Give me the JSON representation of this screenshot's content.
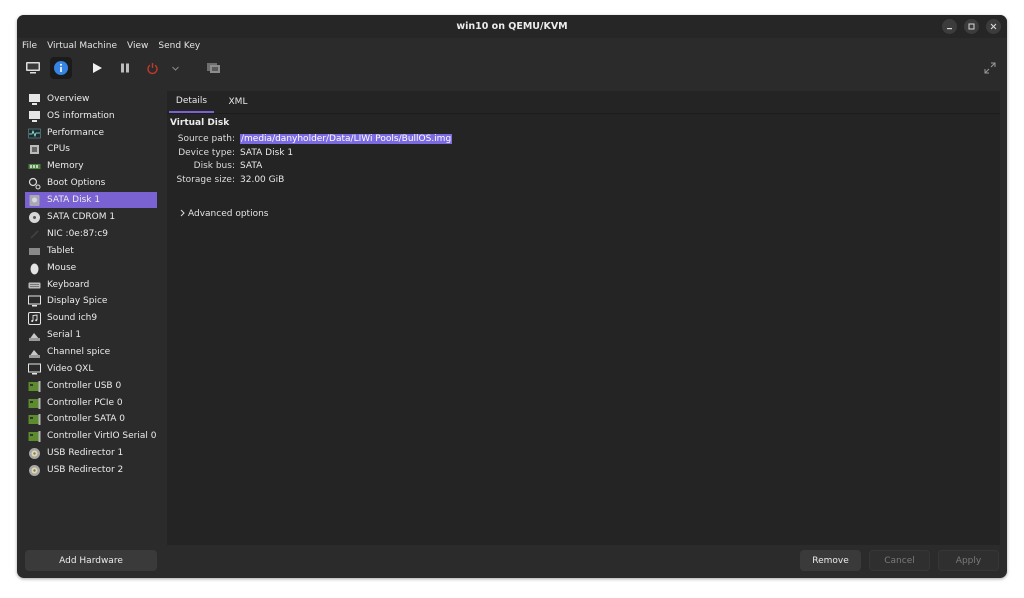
{
  "window": {
    "title": "win10 on QEMU/KVM"
  },
  "menubar": {
    "items": [
      "File",
      "Virtual Machine",
      "View",
      "Send Key"
    ]
  },
  "toolbar": {
    "icons": [
      "monitor-icon",
      "info-icon",
      "play-icon",
      "pause-icon",
      "power-icon",
      "chevron-down-icon",
      "snapshot-icon",
      "fullscreen-icon"
    ]
  },
  "sidebar": {
    "selected_index": 6,
    "items": [
      {
        "label": "Overview",
        "icon": "overview-icon"
      },
      {
        "label": "OS information",
        "icon": "os-info-icon"
      },
      {
        "label": "Performance",
        "icon": "performance-icon"
      },
      {
        "label": "CPUs",
        "icon": "cpu-icon"
      },
      {
        "label": "Memory",
        "icon": "memory-icon"
      },
      {
        "label": "Boot Options",
        "icon": "boot-options-icon"
      },
      {
        "label": "SATA Disk 1",
        "icon": "disk-icon"
      },
      {
        "label": "SATA CDROM 1",
        "icon": "cdrom-icon"
      },
      {
        "label": "NIC :0e:87:c9",
        "icon": "nic-icon"
      },
      {
        "label": "Tablet",
        "icon": "tablet-icon"
      },
      {
        "label": "Mouse",
        "icon": "mouse-icon"
      },
      {
        "label": "Keyboard",
        "icon": "keyboard-icon"
      },
      {
        "label": "Display Spice",
        "icon": "display-icon"
      },
      {
        "label": "Sound ich9",
        "icon": "sound-icon"
      },
      {
        "label": "Serial 1",
        "icon": "serial-icon"
      },
      {
        "label": "Channel spice",
        "icon": "channel-icon"
      },
      {
        "label": "Video QXL",
        "icon": "video-icon"
      },
      {
        "label": "Controller USB 0",
        "icon": "controller-icon"
      },
      {
        "label": "Controller PCIe 0",
        "icon": "controller-icon"
      },
      {
        "label": "Controller SATA 0",
        "icon": "controller-icon"
      },
      {
        "label": "Controller VirtIO Serial 0",
        "icon": "controller-icon"
      },
      {
        "label": "USB Redirector 1",
        "icon": "usb-redirector-icon"
      },
      {
        "label": "USB Redirector 2",
        "icon": "usb-redirector-icon"
      }
    ],
    "add_hardware_label": "Add Hardware"
  },
  "main": {
    "tabs": [
      {
        "label": "Details",
        "active": true
      },
      {
        "label": "XML",
        "active": false
      }
    ],
    "section_title": "Virtual Disk",
    "fields": [
      {
        "label": "Source path:",
        "value": "/media/danyholder/Data/LIWi Pools/BullOS.img",
        "highlighted": true
      },
      {
        "label": "Device type:",
        "value": "SATA Disk 1"
      },
      {
        "label": "Disk bus:",
        "value": "SATA"
      },
      {
        "label": "Storage size:",
        "value": "32.00 GiB"
      }
    ],
    "advanced_label": "Advanced options"
  },
  "footer": {
    "remove_label": "Remove",
    "cancel_label": "Cancel",
    "apply_label": "Apply"
  },
  "colors": {
    "accent": "#7a62d2",
    "window_bg": "#2b2b2b",
    "panel_bg": "#242424",
    "power_red": "#c0392b",
    "info_blue": "#3584e4"
  }
}
